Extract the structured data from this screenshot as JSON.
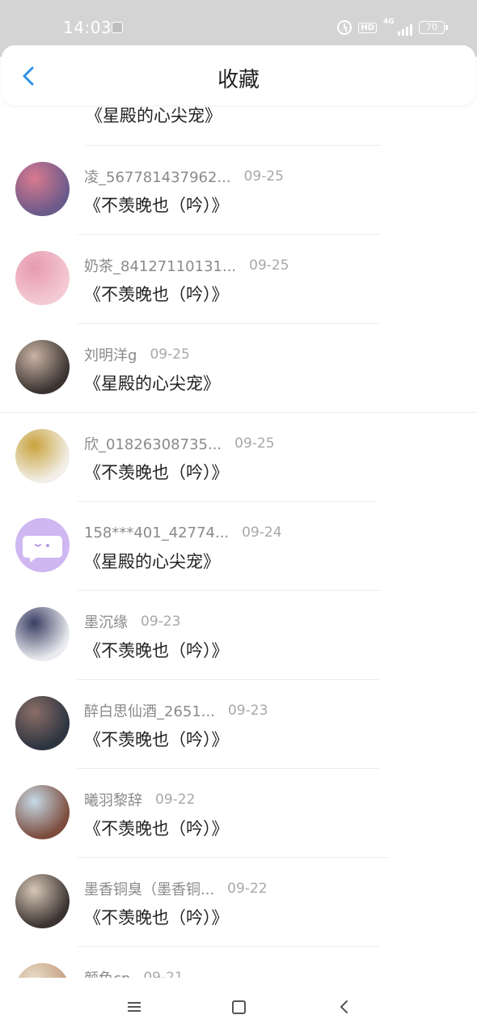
{
  "status_bar": {
    "time": "14:03",
    "hd": "HD",
    "network": "4G",
    "battery": "70"
  },
  "header": {
    "title": "收藏"
  },
  "list": {
    "partial_top_title": "《星殿的心尖宠》",
    "items": [
      {
        "username": "凌_567781437962...",
        "date": "09-25",
        "title": "《不羡晚也（吟）》",
        "avatar_colors": [
          "#6a5a8a",
          "#d97a8f"
        ]
      },
      {
        "username": "奶茶_84127110131...",
        "date": "09-25",
        "title": "《不羡晚也（吟）》",
        "avatar_colors": [
          "#f3c9d3",
          "#e79ab0"
        ]
      },
      {
        "username": "刘明洋g",
        "date": "09-25",
        "title": "《星殿的心尖宠》",
        "avatar_colors": [
          "#3a3330",
          "#c9b3a4"
        ]
      },
      {
        "username": "欣_01826308735...",
        "date": "09-25",
        "title": "《不羡晚也（吟）》",
        "avatar_colors": [
          "#f2efe8",
          "#c9a33e"
        ]
      },
      {
        "username": "158***401_42774...",
        "date": "09-24",
        "title": "《星殿的心尖宠》",
        "avatar_colors": [
          "#cfb7f2",
          "#cfb7f2"
        ]
      },
      {
        "username": "墨沉缘",
        "date": "09-23",
        "title": "《不羡晚也（吟）》",
        "avatar_colors": [
          "#e9ebef",
          "#3a3f63"
        ]
      },
      {
        "username": "醉白思仙酒_2651...",
        "date": "09-23",
        "title": "《不羡晚也（吟）》",
        "avatar_colors": [
          "#2c3440",
          "#8b6e67"
        ]
      },
      {
        "username": "曦羽黎辞",
        "date": "09-22",
        "title": "《不羡晚也（吟）》",
        "avatar_colors": [
          "#7c4c3d",
          "#c6d9e6"
        ]
      },
      {
        "username": "墨香铜臭（墨香铜...",
        "date": "09-22",
        "title": "《不羡晚也（吟）》",
        "avatar_colors": [
          "#3b3331",
          "#d6c7b6"
        ]
      },
      {
        "username": "颜色cn",
        "date": "09-21",
        "title": "",
        "avatar_colors": [
          "#c49a7c",
          "#e8dcc8"
        ]
      }
    ]
  },
  "colors": {
    "accent": "#2b93e8",
    "status_bar_bg": "#d4d4d4",
    "avatar_bubble_icon": "#ffffff"
  }
}
